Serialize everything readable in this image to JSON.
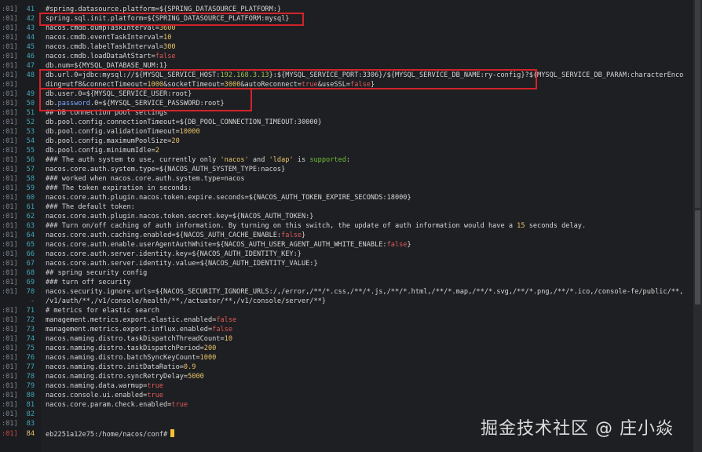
{
  "editor": {
    "lines": [
      {
        "prefix": ":01]",
        "num": "41",
        "segs": [
          {
            "t": "#spring.datasource.platform=${SPRING_DATASOURCE_PLATFORM:}",
            "c": ""
          }
        ]
      },
      {
        "prefix": ":01]",
        "num": "42",
        "segs": [
          {
            "t": "spring.sql.init.platform=${SPRING_DATASOURCE_PLATFORM:mysql}",
            "c": ""
          }
        ]
      },
      {
        "prefix": ":01]",
        "num": "43",
        "segs": [
          {
            "t": "nacos.cmdb.dumpTaskInterval=",
            "c": ""
          },
          {
            "t": "3600",
            "c": "tok-num"
          }
        ]
      },
      {
        "prefix": ":01]",
        "num": "44",
        "segs": [
          {
            "t": "nacos.cmdb.eventTaskInterval=",
            "c": ""
          },
          {
            "t": "10",
            "c": "tok-num"
          }
        ]
      },
      {
        "prefix": ":01]",
        "num": "45",
        "segs": [
          {
            "t": "nacos.cmdb.labelTaskInterval=",
            "c": ""
          },
          {
            "t": "300",
            "c": "tok-num"
          }
        ]
      },
      {
        "prefix": ":01]",
        "num": "46",
        "segs": [
          {
            "t": "nacos.cmdb.loadDataAtStart=",
            "c": ""
          },
          {
            "t": "false",
            "c": "tok-bool"
          }
        ]
      },
      {
        "prefix": ":01]",
        "num": "47",
        "segs": [
          {
            "t": "db.num=${MYSQL_DATABASE_NUM:1}",
            "c": ""
          }
        ]
      },
      {
        "prefix": ":01]",
        "num": "48",
        "segs": [
          {
            "t": "db.url.0=jdbc:mysql://${MYSQL_SERVICE_HOST:",
            "c": ""
          },
          {
            "t": "192.168.3.13",
            "c": "tok-addr"
          },
          {
            "t": "}:${MYSQL_SERVICE_PORT:3306}/${MYSQL_SERVICE_DB_NAME:ry-config}?${MYSQL_SERVICE_DB_PARAM:characterEnco",
            "c": ""
          }
        ]
      },
      {
        "prefix": ":01]",
        "num": "",
        "segs": [
          {
            "t": "ding=utf8&connectTimeout=",
            "c": ""
          },
          {
            "t": "1000",
            "c": "tok-num"
          },
          {
            "t": "&socketTimeout=",
            "c": ""
          },
          {
            "t": "3000",
            "c": "tok-num"
          },
          {
            "t": "&autoReconnect=",
            "c": ""
          },
          {
            "t": "true",
            "c": "tok-bool"
          },
          {
            "t": "&useSSL=",
            "c": ""
          },
          {
            "t": "false",
            "c": "tok-bool"
          },
          {
            "t": "}",
            "c": ""
          }
        ]
      },
      {
        "prefix": ":01]",
        "num": "49",
        "segs": [
          {
            "t": "db.user.0=${MYSQL_SERVICE_USER:root}",
            "c": ""
          }
        ]
      },
      {
        "prefix": ":01]",
        "num": "50",
        "segs": [
          {
            "t": "db.",
            "c": ""
          },
          {
            "t": "password",
            "c": "tok-key"
          },
          {
            "t": ".0=${MYSQL_SERVICE_PASSWORD:root}",
            "c": ""
          }
        ]
      },
      {
        "prefix": ":01]",
        "num": "51",
        "segs": [
          {
            "t": "## DB connection pool settings",
            "c": ""
          }
        ]
      },
      {
        "prefix": ":01]",
        "num": "52",
        "segs": [
          {
            "t": "db.pool.config.connectionTimeout=${DB_POOL_CONNECTION_TIMEOUT:30000}",
            "c": ""
          }
        ]
      },
      {
        "prefix": ":01]",
        "num": "53",
        "segs": [
          {
            "t": "db.pool.config.validationTimeout=",
            "c": ""
          },
          {
            "t": "10000",
            "c": "tok-num"
          }
        ]
      },
      {
        "prefix": ":01]",
        "num": "54",
        "segs": [
          {
            "t": "db.pool.config.maximumPoolSize=",
            "c": ""
          },
          {
            "t": "20",
            "c": "tok-num"
          }
        ]
      },
      {
        "prefix": ":01]",
        "num": "55",
        "segs": [
          {
            "t": "db.pool.config.minimumIdle=",
            "c": ""
          },
          {
            "t": "2",
            "c": "tok-num"
          }
        ]
      },
      {
        "prefix": ":01]",
        "num": "56",
        "segs": [
          {
            "t": "### The auth system to use, currently only ",
            "c": ""
          },
          {
            "t": "'nacos'",
            "c": "tok-str"
          },
          {
            "t": " and ",
            "c": ""
          },
          {
            "t": "'ldap'",
            "c": "tok-str"
          },
          {
            "t": " is ",
            "c": ""
          },
          {
            "t": "supported",
            "c": "tok-sup"
          },
          {
            "t": ":",
            "c": ""
          }
        ]
      },
      {
        "prefix": ":01]",
        "num": "57",
        "segs": [
          {
            "t": "nacos.core.auth.system.type=${NACOS_AUTH_SYSTEM_TYPE:nacos}",
            "c": ""
          }
        ]
      },
      {
        "prefix": ":01]",
        "num": "58",
        "segs": [
          {
            "t": "### worked when nacos.core.auth.system.type=nacos",
            "c": ""
          }
        ]
      },
      {
        "prefix": ":01]",
        "num": "59",
        "segs": [
          {
            "t": "### The token expiration in seconds:",
            "c": ""
          }
        ]
      },
      {
        "prefix": ":01]",
        "num": "60",
        "segs": [
          {
            "t": "nacos.core.auth.plugin.nacos.token.expire.seconds=${NACOS_AUTH_TOKEN_EXPIRE_SECONDS:18000}",
            "c": ""
          }
        ]
      },
      {
        "prefix": ":01]",
        "num": "61",
        "segs": [
          {
            "t": "### The default token:",
            "c": ""
          }
        ]
      },
      {
        "prefix": ":01]",
        "num": "62",
        "segs": [
          {
            "t": "nacos.core.auth.plugin.nacos.token.secret.key=${NACOS_AUTH_TOKEN:}",
            "c": ""
          }
        ]
      },
      {
        "prefix": ":01]",
        "num": "63",
        "segs": [
          {
            "t": "### Turn on/off caching of auth information. By turning on this switch, the update of auth information would have a ",
            "c": ""
          },
          {
            "t": "15",
            "c": "tok-num"
          },
          {
            "t": " seconds delay.",
            "c": ""
          }
        ]
      },
      {
        "prefix": ":01]",
        "num": "64",
        "segs": [
          {
            "t": "nacos.core.auth.caching.enabled=${NACOS_AUTH_CACHE_ENABLE:",
            "c": ""
          },
          {
            "t": "false",
            "c": "tok-bool"
          },
          {
            "t": "}",
            "c": ""
          }
        ]
      },
      {
        "prefix": ":01]",
        "num": "65",
        "segs": [
          {
            "t": "nacos.core.auth.enable.userAgentAuthWhite=${NACOS_AUTH_USER_AGENT_AUTH_WHITE_ENABLE:",
            "c": ""
          },
          {
            "t": "false",
            "c": "tok-bool"
          },
          {
            "t": "}",
            "c": ""
          }
        ]
      },
      {
        "prefix": ":01]",
        "num": "66",
        "segs": [
          {
            "t": "nacos.core.auth.server.identity.key=${NACOS_AUTH_IDENTITY_KEY:}",
            "c": ""
          }
        ]
      },
      {
        "prefix": ":01]",
        "num": "67",
        "segs": [
          {
            "t": "nacos.core.auth.server.identity.value=${NACOS_AUTH_IDENTITY_VALUE:}",
            "c": ""
          }
        ]
      },
      {
        "prefix": ":01]",
        "num": "68",
        "segs": [
          {
            "t": "## spring security config",
            "c": ""
          }
        ]
      },
      {
        "prefix": ":01]",
        "num": "69",
        "segs": [
          {
            "t": "### turn off security",
            "c": ""
          }
        ]
      },
      {
        "prefix": ":01]",
        "num": "70",
        "segs": [
          {
            "t": "nacos.security.ignore.urls=${NACOS_SECURITY_IGNORE_URLS:/,/error,/**/*.css,/**/*.js,/**/*.html,/**/*.map,/**/*.svg,/**/*.png,/**/*.ico,/console-fe/public/**,",
            "c": ""
          }
        ]
      },
      {
        "prefix": "",
        "num": "-",
        "segs": [
          {
            "t": "/v1/auth/**,/v1/console/health/**,/actuator/**,/v1/console/server/**}",
            "c": ""
          }
        ]
      },
      {
        "prefix": ":01]",
        "num": "71",
        "segs": [
          {
            "t": "# metrics for elastic search",
            "c": ""
          }
        ]
      },
      {
        "prefix": ":01]",
        "num": "72",
        "segs": [
          {
            "t": "management.metrics.export.elastic.enabled=",
            "c": ""
          },
          {
            "t": "false",
            "c": "tok-bool"
          }
        ]
      },
      {
        "prefix": ":01]",
        "num": "73",
        "segs": [
          {
            "t": "management.metrics.export.influx.enabled=",
            "c": ""
          },
          {
            "t": "false",
            "c": "tok-bool"
          }
        ]
      },
      {
        "prefix": ":01]",
        "num": "74",
        "segs": [
          {
            "t": "nacos.naming.distro.taskDispatchThreadCount=",
            "c": ""
          },
          {
            "t": "10",
            "c": "tok-num"
          }
        ]
      },
      {
        "prefix": ":01]",
        "num": "75",
        "segs": [
          {
            "t": "nacos.naming.distro.taskDispatchPeriod=",
            "c": ""
          },
          {
            "t": "200",
            "c": "tok-num"
          }
        ]
      },
      {
        "prefix": ":01]",
        "num": "76",
        "segs": [
          {
            "t": "nacos.naming.distro.batchSyncKeyCount=",
            "c": ""
          },
          {
            "t": "1000",
            "c": "tok-num"
          }
        ]
      },
      {
        "prefix": ":01]",
        "num": "77",
        "segs": [
          {
            "t": "nacos.naming.distro.initDataRatio=",
            "c": ""
          },
          {
            "t": "0.9",
            "c": "tok-num"
          }
        ]
      },
      {
        "prefix": ":01]",
        "num": "78",
        "segs": [
          {
            "t": "nacos.naming.distro.syncRetryDelay=",
            "c": ""
          },
          {
            "t": "5000",
            "c": "tok-num"
          }
        ]
      },
      {
        "prefix": ":01]",
        "num": "79",
        "segs": [
          {
            "t": "nacos.naming.data.warmup=",
            "c": ""
          },
          {
            "t": "true",
            "c": "tok-bool"
          }
        ]
      },
      {
        "prefix": ":01]",
        "num": "80",
        "segs": [
          {
            "t": "nacos.console.ui.enabled=",
            "c": ""
          },
          {
            "t": "true",
            "c": "tok-bool"
          }
        ]
      },
      {
        "prefix": ":01]",
        "num": "81",
        "segs": [
          {
            "t": "nacos.core.param.check.enabled=",
            "c": ""
          },
          {
            "t": "true",
            "c": "tok-bool"
          }
        ]
      },
      {
        "prefix": ":01]",
        "num": "82",
        "segs": []
      },
      {
        "prefix": ":01]",
        "num": "83",
        "segs": []
      }
    ]
  },
  "prompt": {
    "prefix": ":01]",
    "num": "84",
    "text": "eb2251a12e75:/home/nacos/conf#"
  },
  "watermark": "掘金技术社区 @ 庄小焱",
  "colors": {
    "highlight_box": "#d2232a",
    "cursor": "#f2c033"
  }
}
